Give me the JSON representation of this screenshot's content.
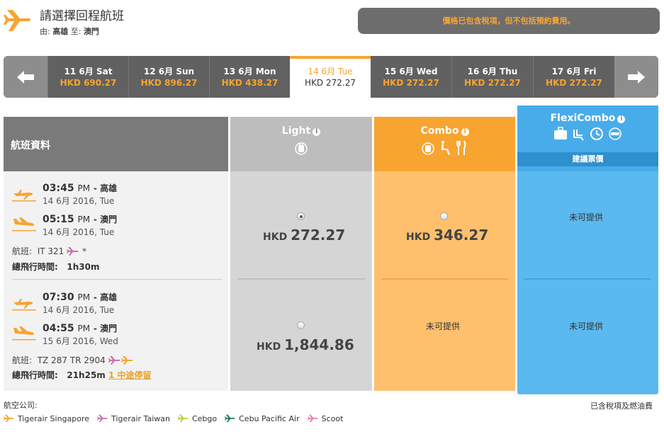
{
  "header": {
    "title": "請選擇回程航班",
    "from_label": "由:",
    "from_city": "高雄",
    "to_label": "至:",
    "to_city": "澳門",
    "notice": "價格已包含稅項，但不包括預約費用。"
  },
  "datebar": {
    "days": [
      {
        "date": "11 6月 Sat",
        "price": "HKD 690.27"
      },
      {
        "date": "12 6月 Sun",
        "price": "HKD 896.27"
      },
      {
        "date": "13 6月 Mon",
        "price": "HKD 438.27"
      },
      {
        "date": "14 6月 Tue",
        "price": "HKD 272.27"
      },
      {
        "date": "15 6月 Wed",
        "price": "HKD 272.27"
      },
      {
        "date": "16 6月 Thu",
        "price": "HKD 272.27"
      },
      {
        "date": "17 6月 Fri",
        "price": "HKD 272.27"
      }
    ]
  },
  "columns": {
    "info_title": "航班資料",
    "light": "Light",
    "combo": "Combo",
    "flexi": "FlexiCombo",
    "flexi_band": "建議票價"
  },
  "flights": [
    {
      "dep_time": "03:45",
      "dep_ampm": "PM",
      "dep_city": "- 高雄",
      "dep_date": "14 6月 2016, Tue",
      "arr_time": "05:15",
      "arr_ampm": "PM",
      "arr_city": "- 澳門",
      "arr_date": "14 6月 2016, Tue",
      "flight_label": "航班:",
      "flight_no": "IT 321",
      "star": "*",
      "duration_label": "總飛行時間:",
      "duration": "1h30m",
      "stop": "",
      "light_currency": "HKD",
      "light_price": "272.27",
      "combo_currency": "HKD",
      "combo_price": "346.27",
      "flexi_na": "未可提供"
    },
    {
      "dep_time": "07:30",
      "dep_ampm": "PM",
      "dep_city": "- 高雄",
      "dep_date": "14 6月 2016, Tue",
      "arr_time": "04:55",
      "arr_ampm": "PM",
      "arr_city": "- 澳門",
      "arr_date": "15 6月 2016, Wed",
      "flight_label": "航班:",
      "flight_no": "TZ 287 TR 2904",
      "duration_label": "總飛行時間:",
      "duration": "21h25m",
      "stop": "1 中途停留",
      "light_currency": "HKD",
      "light_price": "1,844.86",
      "combo_na": "未可提供",
      "flexi_na": "未可提供"
    }
  ],
  "footer": {
    "airline_label": "航空公司:",
    "tax_note": "已含稅項及燃油費",
    "airlines": [
      {
        "name": "Tigerair Singapore",
        "color": "#f7a431"
      },
      {
        "name": "Tigerair Taiwan",
        "color": "#c86fb0"
      },
      {
        "name": "Cebgo",
        "color": "#b8cc3a"
      },
      {
        "name": "Cebu Pacific Air",
        "color": "#1c7c5c"
      },
      {
        "name": "Scoot",
        "color": "#f07aaf"
      }
    ]
  },
  "colors": {
    "accent": "#f7a431",
    "flexi_blue": "#5ab9ee",
    "dark_bar": "#616161"
  }
}
